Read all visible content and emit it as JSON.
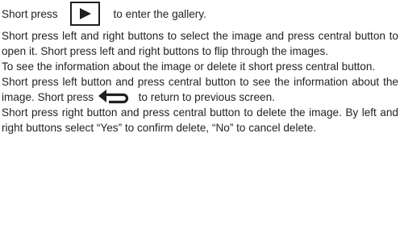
{
  "paragraphs": [
    {
      "before_icon": "Short press",
      "icon": "play-icon",
      "after_icon": "to enter the gallery."
    },
    {
      "text": "Short press left and right buttons to select the image and press central button to open it. Short press left and right buttons to flip through the images."
    },
    {
      "text": "To see the information about the image or delete it short press central button."
    },
    {
      "before_icon": "Short press left button and press central button to see the information about the image. Short press",
      "icon": "back-arrow-icon",
      "after_icon": "to return to previous screen."
    },
    {
      "text": "Short press right button and press central button to delete the image. By left and right buttons select “Yes” to confirm delete, “No” to cancel delete."
    }
  ],
  "colors": {
    "text": "#231f20",
    "background": "#ffffff"
  }
}
